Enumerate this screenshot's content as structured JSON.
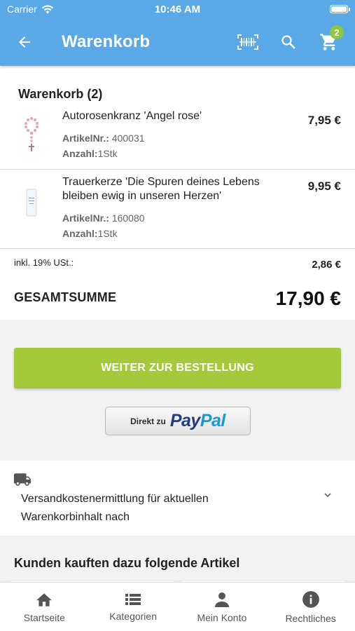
{
  "status_bar": {
    "carrier": "Carrier",
    "time": "10:46 AM",
    "battery_level": 1.0
  },
  "app_bar": {
    "title": "Warenkorb",
    "back_icon": "arrow-left-icon",
    "actions": [
      "barcode-scanner-icon",
      "search-icon",
      "cart-icon"
    ],
    "cart_count": "2",
    "colors": {
      "bar": "#5aa9e6",
      "badge": "#8dc63f"
    }
  },
  "cart": {
    "heading": "Warenkorb (2)",
    "items": [
      {
        "name": "Autorosenkranz 'Angel rose'",
        "price": "7,95 €",
        "article_label": "ArtikelNr.:",
        "article_no": " 400031",
        "qty_label": "Anzahl:",
        "qty": "1Stk"
      },
      {
        "name": "Trauerkerze 'Die Spuren deines Lebens bleiben ewig in unseren Herzen'",
        "price": "9,95 €",
        "article_label": "ArtikelNr.:",
        "article_no": " 160080",
        "qty_label": "Anzahl:",
        "qty": "1Stk"
      }
    ],
    "tax_label": "inkl. 19% USt.:",
    "tax_value": "2,86 €",
    "total_label": "GESAMTSUMME",
    "total_value": "17,90 €"
  },
  "checkout": {
    "label": "WEITER ZUR BESTELLUNG",
    "color": "#a6c93b"
  },
  "paypal": {
    "prefix": "Direkt zu",
    "pay": "Pay",
    "pal": "Pal"
  },
  "shipping": {
    "icon": "truck-icon",
    "text": "Versandkostenermittlung für aktuellen Warenkorbinhalt nach",
    "expand_icon": "chevron-down-icon"
  },
  "recommendations": {
    "heading": "Kunden kauften dazu folgende Artikel"
  },
  "bottom_nav": [
    {
      "label": "Startseite",
      "icon": "home-icon"
    },
    {
      "label": "Kategorien",
      "icon": "list-icon"
    },
    {
      "label": "Mein Konto",
      "icon": "person-icon"
    },
    {
      "label": "Rechtliches",
      "icon": "info-icon"
    }
  ]
}
